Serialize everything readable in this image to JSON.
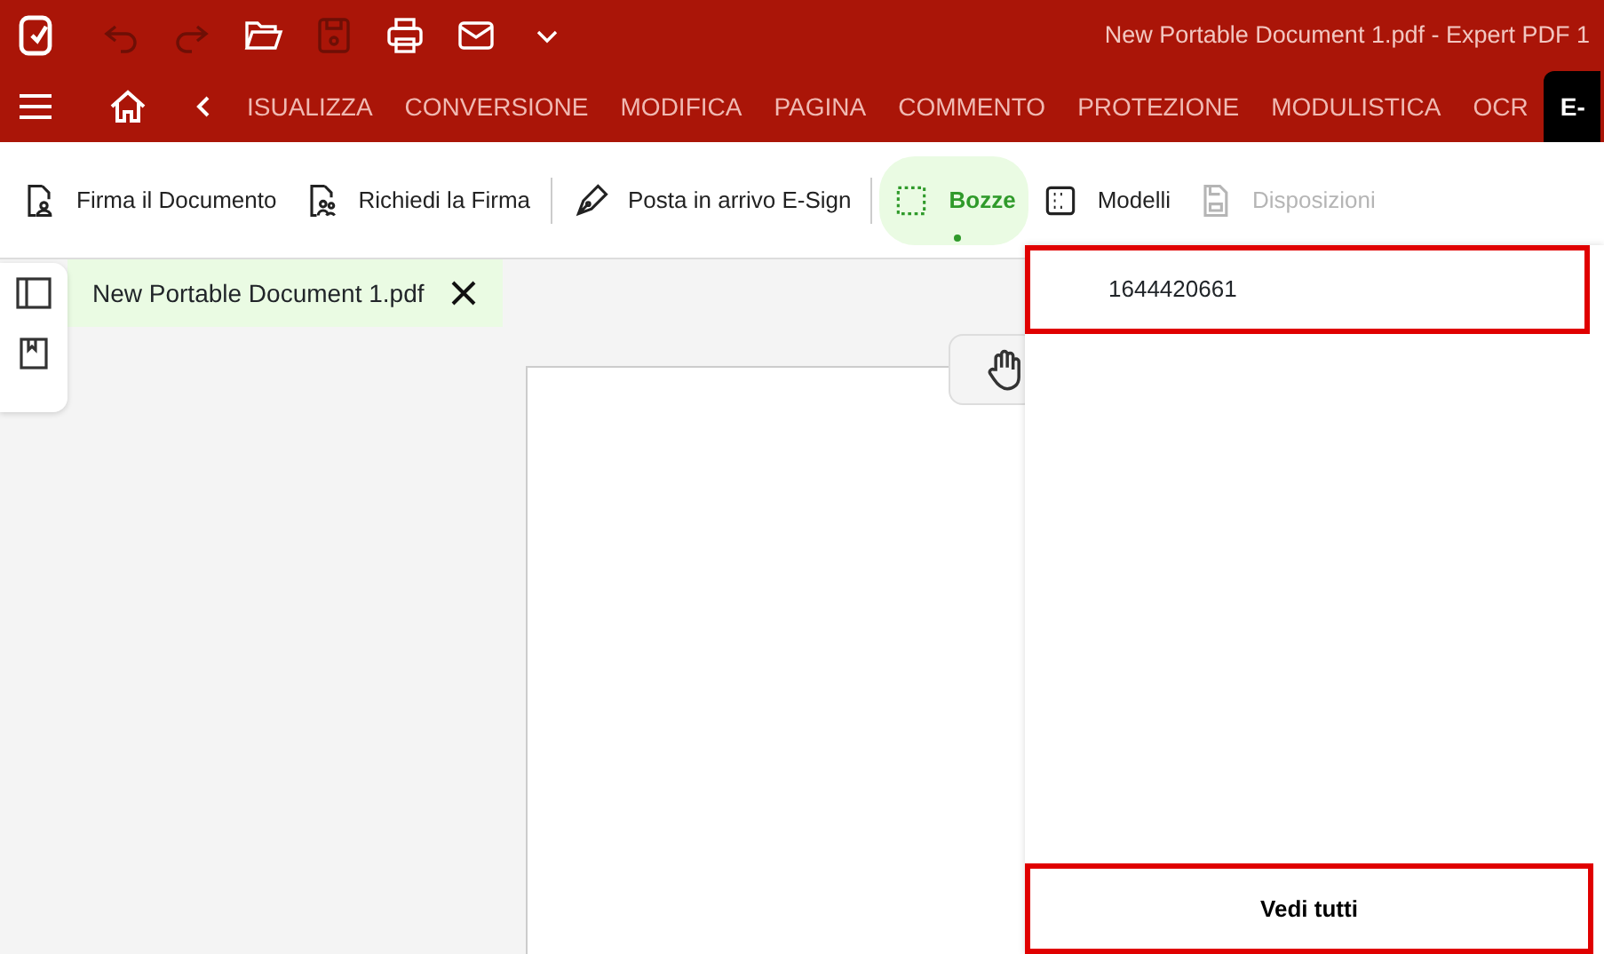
{
  "title_bar": {
    "title": "New Portable Document 1.pdf   -   Expert PDF 1",
    "quick_actions": [
      {
        "disabled": true
      },
      {
        "disabled": true
      },
      {
        "disabled": false
      },
      {
        "disabled": true
      },
      {
        "disabled": false
      },
      {
        "disabled": false
      },
      {
        "disabled": false
      }
    ]
  },
  "ribbon_tabs": [
    {
      "label": "ISUALIZZA",
      "selected": false
    },
    {
      "label": "CONVERSIONE",
      "selected": false
    },
    {
      "label": "MODIFICA",
      "selected": false
    },
    {
      "label": "PAGINA",
      "selected": false
    },
    {
      "label": "COMMENTO",
      "selected": false
    },
    {
      "label": "PROTEZIONE",
      "selected": false
    },
    {
      "label": "MODULISTICA",
      "selected": false
    },
    {
      "label": "OCR",
      "selected": false
    },
    {
      "label": "E-",
      "selected": true
    }
  ],
  "toolbar": [
    {
      "label": "Firma il Documento",
      "selected": false,
      "disabled": false,
      "separator_after": false
    },
    {
      "label": "Richiedi la Firma",
      "selected": false,
      "disabled": false,
      "separator_after": true
    },
    {
      "label": "Posta in arrivo E-Sign",
      "selected": false,
      "disabled": false,
      "separator_after": true
    },
    {
      "label": "Bozze",
      "selected": true,
      "disabled": false,
      "separator_after": false
    },
    {
      "label": "Modelli",
      "selected": false,
      "disabled": false,
      "separator_after": false
    },
    {
      "label": "Disposizioni",
      "selected": false,
      "disabled": true,
      "separator_after": false
    }
  ],
  "document_tab": {
    "label": "New Portable Document 1.pdf"
  },
  "drafts_menu": {
    "items": [
      "1644420661"
    ],
    "footer": "Vedi tutti"
  }
}
